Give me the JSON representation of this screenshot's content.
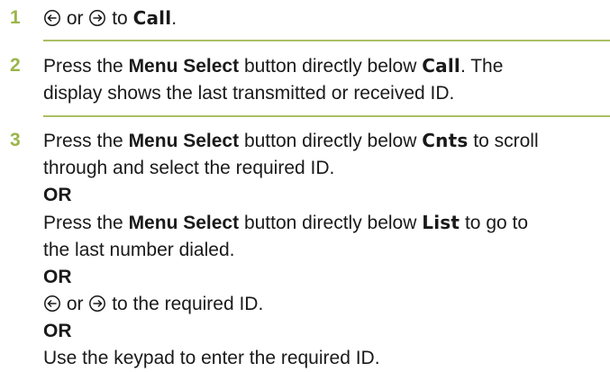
{
  "colors": {
    "step_number": "#9bb54a",
    "divider": "#a9c063",
    "text": "#1a1a1a"
  },
  "icons": {
    "scroll_left": "scroll-left-icon",
    "scroll_right": "scroll-right-icon"
  },
  "steps": [
    {
      "number": "1",
      "or": "or",
      "to": "to",
      "display": "Call",
      "end": "."
    },
    {
      "number": "2",
      "press": "Press the",
      "button": "Menu Select",
      "below": "button directly below",
      "display": "Call",
      "rest": ". The",
      "line2": "display shows the last transmitted or received ID."
    },
    {
      "number": "3",
      "a_press": "Press the",
      "a_button": "Menu Select",
      "a_below": "button directly below",
      "a_display": "Cnts",
      "a_rest": "to scroll",
      "a_line2": "through and select the required ID.",
      "or1": "OR",
      "b_press": "Press the",
      "b_button": "Menu Select",
      "b_below": "button directly below",
      "b_display": "List",
      "b_rest": "to go to",
      "b_line2": "the last number dialed.",
      "or2": "OR",
      "c_or": "or",
      "c_rest": "to the required ID.",
      "or3": "OR",
      "d_text": "Use the keypad to enter the required ID."
    }
  ]
}
